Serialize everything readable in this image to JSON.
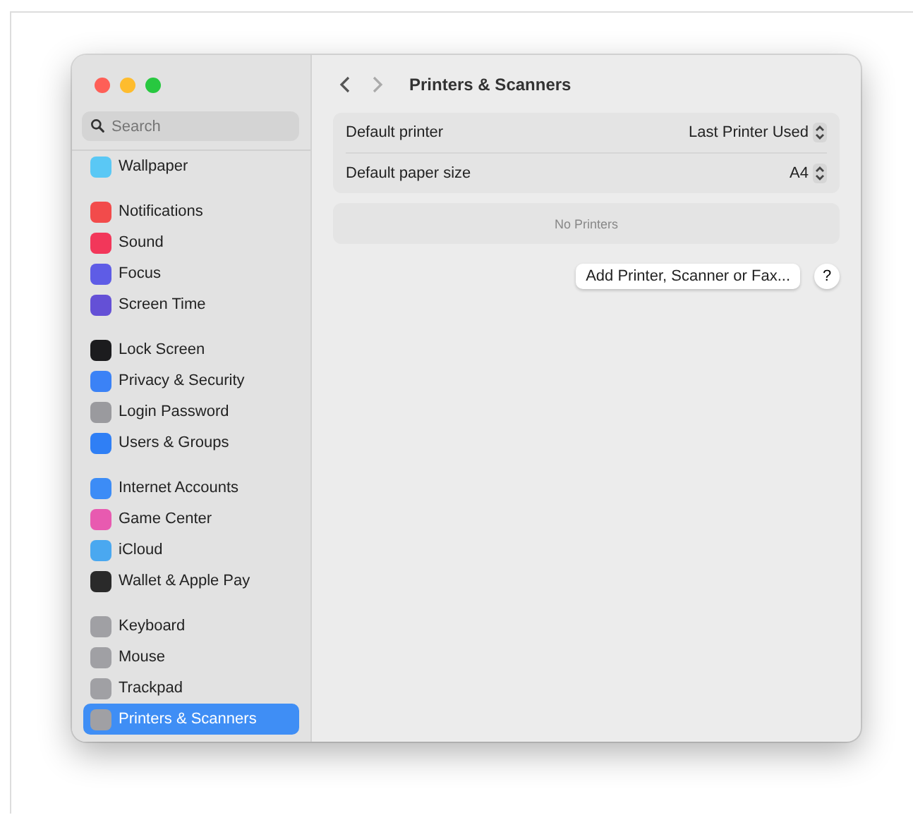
{
  "window": {
    "title": "Printers & Scanners"
  },
  "sidebar": {
    "search": {
      "placeholder": "Search"
    },
    "groups": [
      [
        {
          "label": "Wallpaper",
          "color": "#5ac8f5",
          "selected": false
        }
      ],
      [
        {
          "label": "Notifications",
          "color": "#f24b4b",
          "selected": false
        },
        {
          "label": "Sound",
          "color": "#f2375a",
          "selected": false
        },
        {
          "label": "Focus",
          "color": "#5e5ce6",
          "selected": false
        },
        {
          "label": "Screen Time",
          "color": "#6450d6",
          "selected": false
        }
      ],
      [
        {
          "label": "Lock Screen",
          "color": "#1c1c1e",
          "selected": false
        },
        {
          "label": "Privacy & Security",
          "color": "#3b82f6",
          "selected": false
        },
        {
          "label": "Login Password",
          "color": "#9a9a9e",
          "selected": false
        },
        {
          "label": "Users & Groups",
          "color": "#2f7ff5",
          "selected": false
        }
      ],
      [
        {
          "label": "Internet Accounts",
          "color": "#3c8cf6",
          "selected": false
        },
        {
          "label": "Game Center",
          "color": "#e85ab0",
          "selected": false
        },
        {
          "label": "iCloud",
          "color": "#4aa8f0",
          "selected": false
        },
        {
          "label": "Wallet & Apple Pay",
          "color": "#2a2a2a",
          "selected": false
        }
      ],
      [
        {
          "label": "Keyboard",
          "color": "#a0a0a4",
          "selected": false
        },
        {
          "label": "Mouse",
          "color": "#a0a0a4",
          "selected": false
        },
        {
          "label": "Trackpad",
          "color": "#a0a0a4",
          "selected": false
        },
        {
          "label": "Printers & Scanners",
          "color": "#a0a0a4",
          "selected": true
        }
      ]
    ]
  },
  "settings": [
    {
      "label": "Default printer",
      "value": "Last Printer Used"
    },
    {
      "label": "Default paper size",
      "value": "A4"
    }
  ],
  "printers_list": {
    "empty_text": "No Printers"
  },
  "buttons": {
    "add": "Add Printer, Scanner or Fax...",
    "help": "?"
  }
}
